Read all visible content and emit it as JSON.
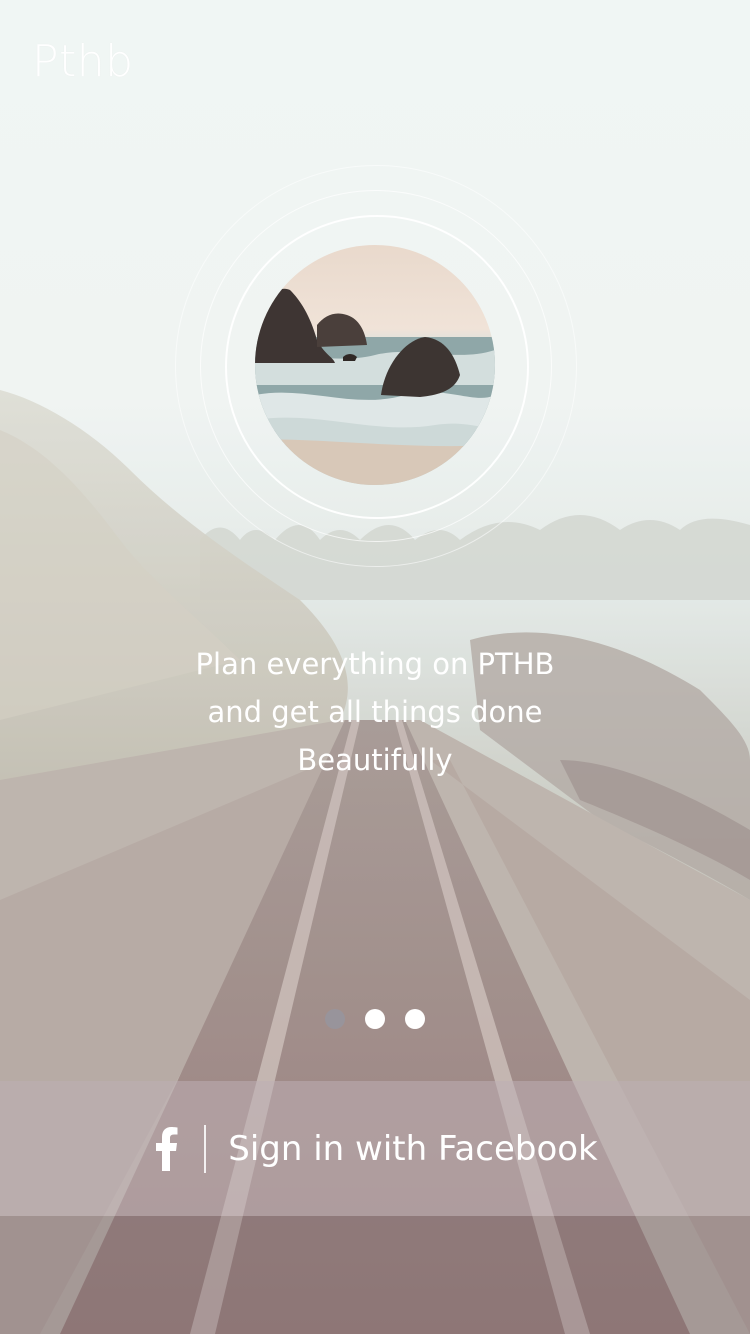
{
  "brand": {
    "title": "Pthb"
  },
  "hero": {
    "tagline_line1": "Plan everything on PTHB",
    "tagline_line2": "and get all things done",
    "tagline_line3": "Beautifully"
  },
  "pager": {
    "count": 3,
    "active_index": 1
  },
  "signin": {
    "icon": "facebook-icon",
    "label": "Sign in with Facebook"
  },
  "colors": {
    "overlay_bar": "#BFAFB4",
    "text": "#FFFFFF"
  }
}
